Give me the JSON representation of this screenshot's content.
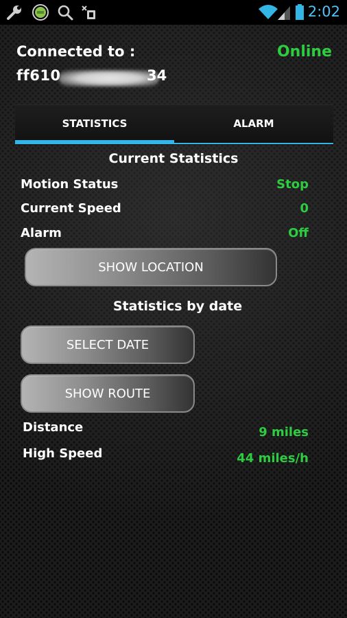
{
  "status_bar": {
    "time": "2:02",
    "icons": [
      "wrench-icon",
      "android-icon",
      "search-icon",
      "download-icon",
      "wifi-icon",
      "signal-icon",
      "battery-icon"
    ],
    "accent_color": "#33b5e5"
  },
  "header": {
    "connected_label": "Connected to :",
    "device_id_prefix": "ff610",
    "device_id_suffix": "34",
    "connection_status": "Online",
    "status_color": "#2ecc40"
  },
  "tabs": [
    {
      "label": "STATISTICS",
      "selected": true
    },
    {
      "label": "ALARM",
      "selected": false
    }
  ],
  "current_stats": {
    "title": "Current Statistics",
    "rows": [
      {
        "label": "Motion Status",
        "value": "Stop"
      },
      {
        "label": "Current Speed",
        "value": "0"
      },
      {
        "label": "Alarm",
        "value": "Off"
      }
    ],
    "show_location_label": "SHOW LOCATION"
  },
  "stats_by_date": {
    "title": "Statistics by date",
    "select_date_label": "SELECT DATE",
    "show_route_label": "SHOW ROUTE",
    "rows": [
      {
        "label": "Distance",
        "value": "9 miles"
      },
      {
        "label": "High Speed",
        "value": "44 miles/h"
      }
    ]
  }
}
